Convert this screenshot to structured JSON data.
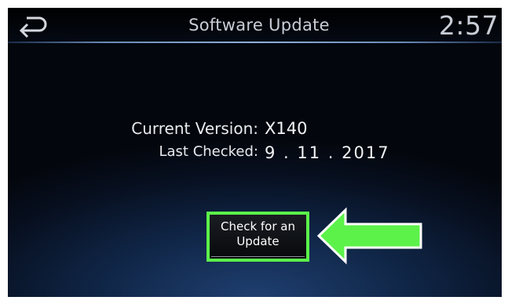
{
  "header": {
    "title": "Software Update",
    "clock": "2:57",
    "back_icon": "back-arrow-icon"
  },
  "info": {
    "current_version_label": "Current Version:",
    "current_version_value": "X140",
    "last_checked_label": "Last Checked:",
    "last_checked_value": "9 . 11 . 2017"
  },
  "actions": {
    "check_update_label": "Check for an\nUpdate"
  },
  "annotation": {
    "icon": "pointer-arrow-icon",
    "color": "#5cf24a"
  },
  "colors": {
    "highlight": "#5cf24a",
    "header_text": "#c9ced6",
    "background": "#0f2444"
  }
}
